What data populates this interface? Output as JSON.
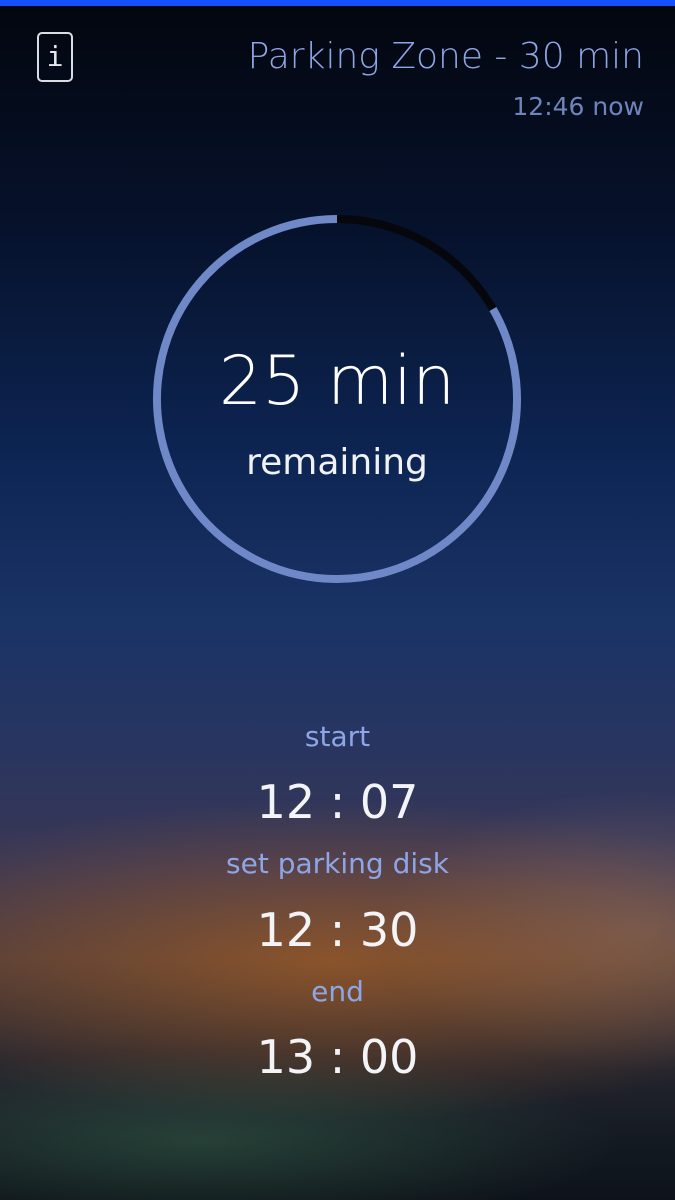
{
  "header": {
    "info_icon_glyph": "i",
    "info_icon": "info-icon",
    "title": "Parking Zone - 30 min",
    "now_text": "12:46 now"
  },
  "timer": {
    "value_text": "25 min",
    "label": "remaining",
    "remaining_fraction": 0.8333,
    "progress_color": "#6f88c8",
    "track_color": "#05070c"
  },
  "schedule": {
    "start_label": "start",
    "start_time": "12 : 07",
    "disk_label": "set parking disk",
    "disk_time": "12 : 30",
    "end_label": "end",
    "end_time": "13 : 00"
  },
  "colors": {
    "accent_top_bar": "#1450ff",
    "label_color": "#8ea6e6"
  }
}
